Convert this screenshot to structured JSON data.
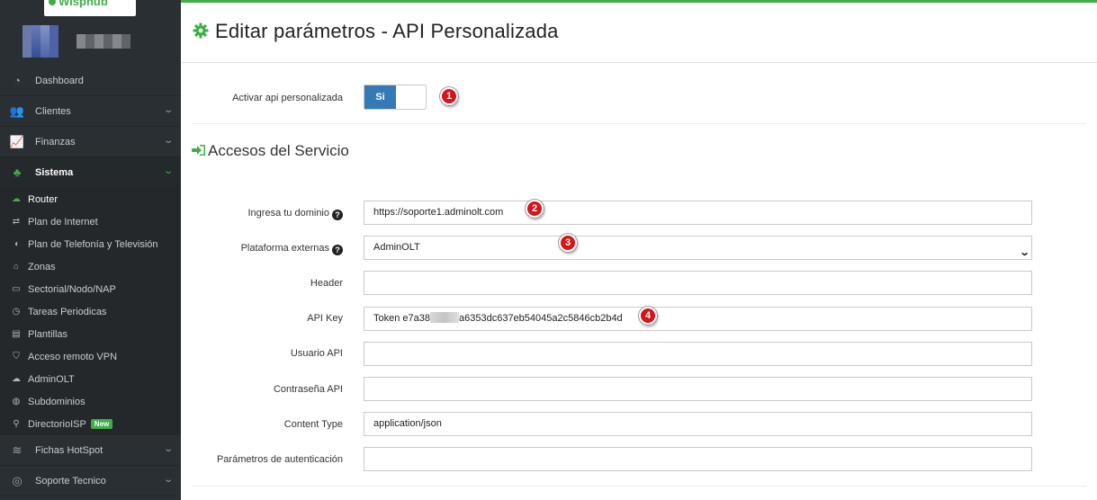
{
  "brand": {
    "name": "Wisphub",
    "accent": "#3fae49"
  },
  "sidebar": {
    "items": [
      {
        "label": "Dashboard",
        "icon": "dashboard-icon",
        "glyph": "◔",
        "chevron": false,
        "active": false
      },
      {
        "label": "Clientes",
        "icon": "users-icon",
        "glyph": "👥",
        "chevron": true,
        "active": false
      },
      {
        "label": "Finanzas",
        "icon": "chart-line-icon",
        "glyph": "📈",
        "chevron": true,
        "active": false
      },
      {
        "label": "Sistema",
        "icon": "sitemap-icon",
        "glyph": "♣",
        "chevron": true,
        "active": true
      }
    ],
    "subitems": [
      {
        "label": "Router",
        "icon": "cloud-icon",
        "glyph": "☁",
        "current": true
      },
      {
        "label": "Plan de Internet",
        "icon": "exchange-icon",
        "glyph": "⇄"
      },
      {
        "label": "Plan de Telefonía y Televisión",
        "icon": "volume-icon",
        "glyph": "◖"
      },
      {
        "label": "Zonas",
        "icon": "home-icon",
        "glyph": "⌂"
      },
      {
        "label": "Sectorial/Nodo/NAP",
        "icon": "desktop-icon",
        "glyph": "▭"
      },
      {
        "label": "Tareas Periodicas",
        "icon": "clock-icon",
        "glyph": "◷"
      },
      {
        "label": "Plantillas",
        "icon": "file-icon",
        "glyph": "▤"
      },
      {
        "label": "Acceso remoto VPN",
        "icon": "shield-icon",
        "glyph": "⛉"
      },
      {
        "label": "AdminOLT",
        "icon": "cloud-icon",
        "glyph": "☁"
      },
      {
        "label": "Subdominios",
        "icon": "globe-icon",
        "glyph": "◍"
      },
      {
        "label": "DirectorioISP",
        "icon": "map-marker-icon",
        "glyph": "⚲",
        "badge": "New"
      }
    ],
    "bottom_items": [
      {
        "label": "Fichas HotSpot",
        "icon": "wifi-icon",
        "glyph": "≋",
        "chevron": true
      },
      {
        "label": "Soporte Tecnico",
        "icon": "support-icon",
        "glyph": "◎",
        "chevron": true
      }
    ]
  },
  "header": {
    "title": "Editar parámetros - API Personalizada"
  },
  "activate": {
    "label": "Activar api personalizada",
    "toggle_value": "Si"
  },
  "section": {
    "title": "Accesos del Servicio"
  },
  "fields": {
    "domain": {
      "label": "Ingresa tu dominio",
      "value": "https://soporte1.adminolt.com"
    },
    "platform": {
      "label": "Plataforma externas",
      "value": "AdminOLT"
    },
    "header": {
      "label": "Header",
      "value": ""
    },
    "api_key": {
      "label": "API Key",
      "value_prefix": "Token e7a38",
      "value_suffix": "a6353dc637eb54045a2c5846cb2b4d"
    },
    "api_user": {
      "label": "Usuario API",
      "value": ""
    },
    "api_password": {
      "label": "Contraseña API",
      "value": ""
    },
    "content_type": {
      "label": "Content Type",
      "value": "application/json"
    },
    "auth_params": {
      "label": "Parámetros de autenticación",
      "value": ""
    }
  },
  "markers": [
    "1",
    "2",
    "3",
    "4"
  ]
}
